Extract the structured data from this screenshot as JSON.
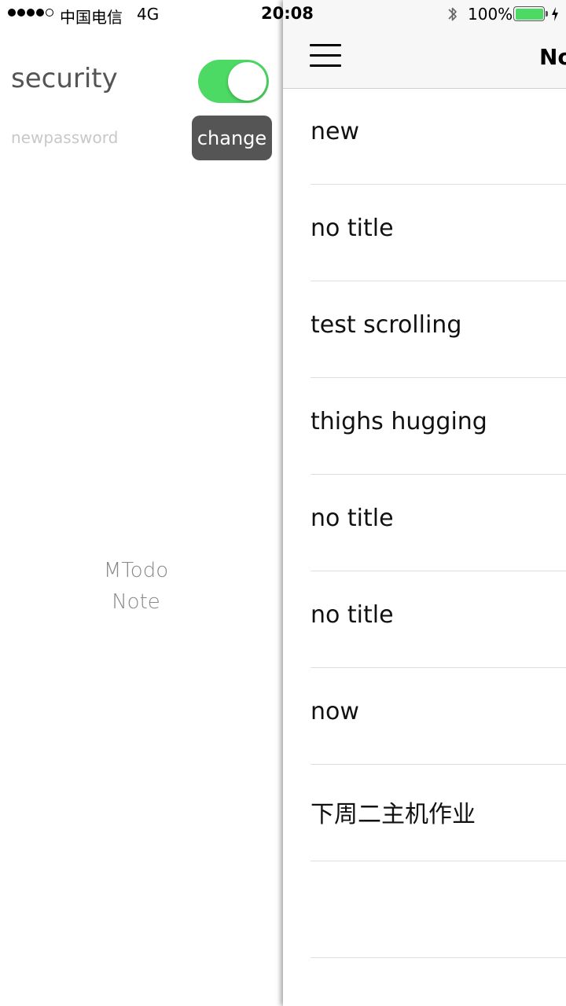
{
  "status_bar": {
    "carrier": "中国电信",
    "network": "4G",
    "time": "20:08",
    "battery_percent": "100%",
    "battery_level": 1.0,
    "battery_color": "#4cd964"
  },
  "menu": {
    "security_label": "security",
    "security_enabled": true,
    "password_placeholder": "newpassword",
    "change_label": "change",
    "app_name_line1": "MTodo",
    "app_name_line2": "Note"
  },
  "main": {
    "nav_title": "No",
    "notes": [
      {
        "title": "new"
      },
      {
        "title": "no title"
      },
      {
        "title": "test scrolling"
      },
      {
        "title": "thighs hugging"
      },
      {
        "title": "no title"
      },
      {
        "title": "no title"
      },
      {
        "title": "now"
      },
      {
        "title": "下周二主机作业"
      },
      {
        "title": ""
      }
    ]
  },
  "colors": {
    "toggle_on": "#4cd964",
    "button_bg": "#555555"
  }
}
